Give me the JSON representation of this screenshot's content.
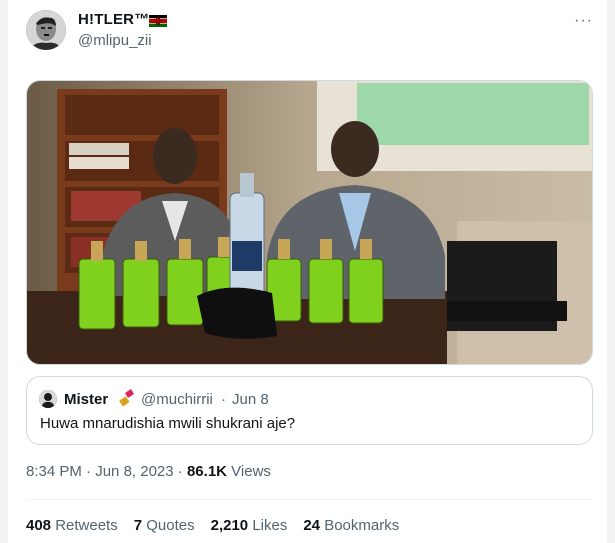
{
  "author": {
    "display_name": "H!TLER™",
    "handle": "@mlipu_zii",
    "flag_icon": "kenya-flag-icon"
  },
  "more_icon": "···",
  "quoted_tweet": {
    "name": "Mister",
    "emoji_icon": "lipstick-icon",
    "handle": "@muchirrii",
    "separator": "·",
    "date": "Jun 8",
    "text": "Huwa mnarudishia mwili shukrani aje?"
  },
  "meta": {
    "time": "8:34 PM",
    "separator1": " · ",
    "date": "Jun 8, 2023",
    "separator2": " · ",
    "views_count": "86.1K",
    "views_label": " Views"
  },
  "stats": {
    "retweets_count": "408",
    "retweets_label": " Retweets",
    "quotes_count": "7",
    "quotes_label": " Quotes",
    "likes_count": "2,210",
    "likes_label": " Likes",
    "bookmarks_count": "24",
    "bookmarks_label": " Bookmarks"
  },
  "colors": {
    "text_primary": "#0f1419",
    "text_secondary": "#536471",
    "border": "#cfd9de"
  }
}
